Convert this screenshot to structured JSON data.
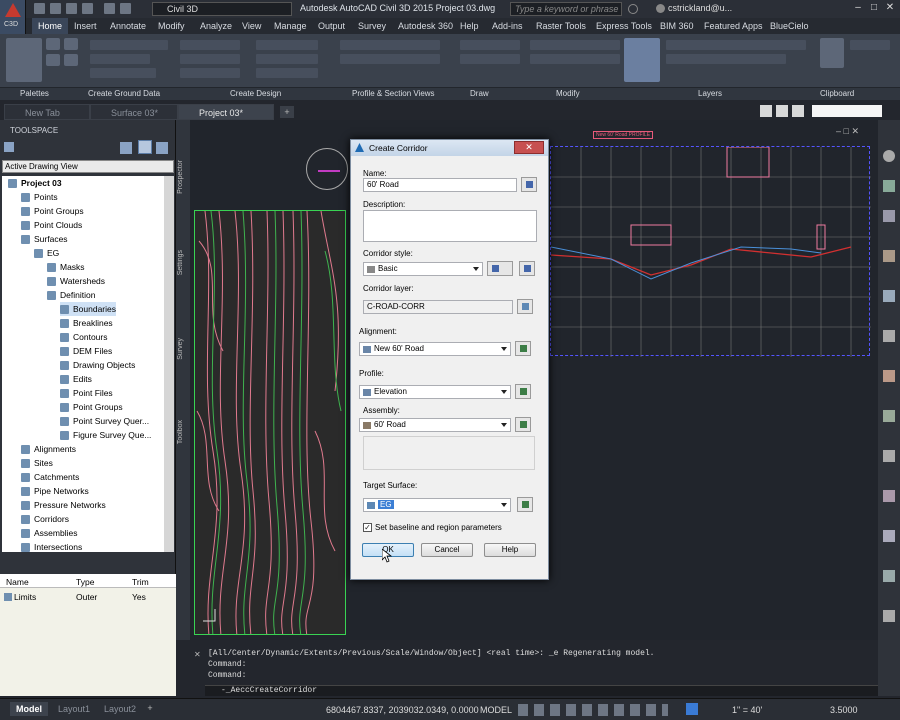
{
  "app": {
    "workspace": "Civil 3D",
    "title": "Autodesk AutoCAD Civil 3D 2015   Project 03.dwg",
    "search_placeholder": "Type a keyword or phrase",
    "user": "cstrickland@u...",
    "app_button_label": "C3D"
  },
  "ribbon": {
    "tabs": [
      "Home",
      "Insert",
      "Annotate",
      "Modify",
      "Analyze",
      "View",
      "Manage",
      "Output",
      "Survey",
      "Autodesk 360",
      "Help",
      "Add-ins",
      "Raster Tools",
      "Express Tools",
      "BIM 360",
      "Featured Apps",
      "BlueCielo"
    ],
    "active_tab": "Home",
    "panels": [
      "Palettes",
      "Create Ground Data",
      "Create Design",
      "Profile & Section Views",
      "Draw",
      "Modify",
      "Layers",
      "Clipboard"
    ]
  },
  "doc_tabs": [
    "New Tab",
    "Surface 03*",
    "Project 03*"
  ],
  "toolspace": {
    "title": "TOOLSPACE",
    "view": "Active Drawing View",
    "side_tabs": [
      "Prospector",
      "Settings",
      "Survey",
      "Toolbox"
    ],
    "tree": [
      {
        "label": "Project 03",
        "level": 0,
        "bold": true
      },
      {
        "label": "Points",
        "level": 1
      },
      {
        "label": "Point Groups",
        "level": 1
      },
      {
        "label": "Point Clouds",
        "level": 1
      },
      {
        "label": "Surfaces",
        "level": 1
      },
      {
        "label": "EG",
        "level": 2
      },
      {
        "label": "Masks",
        "level": 3
      },
      {
        "label": "Watersheds",
        "level": 3
      },
      {
        "label": "Definition",
        "level": 3
      },
      {
        "label": "Boundaries",
        "level": 4,
        "selected": true
      },
      {
        "label": "Breaklines",
        "level": 4
      },
      {
        "label": "Contours",
        "level": 4
      },
      {
        "label": "DEM Files",
        "level": 4
      },
      {
        "label": "Drawing Objects",
        "level": 4
      },
      {
        "label": "Edits",
        "level": 4
      },
      {
        "label": "Point Files",
        "level": 4
      },
      {
        "label": "Point Groups",
        "level": 4
      },
      {
        "label": "Point Survey Quer...",
        "level": 4
      },
      {
        "label": "Figure Survey Que...",
        "level": 4
      },
      {
        "label": "Alignments",
        "level": 1
      },
      {
        "label": "Sites",
        "level": 1
      },
      {
        "label": "Catchments",
        "level": 1
      },
      {
        "label": "Pipe Networks",
        "level": 1
      },
      {
        "label": "Pressure Networks",
        "level": 1
      },
      {
        "label": "Corridors",
        "level": 1
      },
      {
        "label": "Assemblies",
        "level": 1
      },
      {
        "label": "Intersections",
        "level": 1
      }
    ],
    "list_headers": [
      "Name",
      "Type",
      "Trim"
    ],
    "list_rows": [
      [
        "Limits",
        "Outer",
        "Yes"
      ]
    ]
  },
  "dialog": {
    "title": "Create Corridor",
    "close": "✕",
    "name_label": "Name:",
    "name_value": "60' Road",
    "description_label": "Description:",
    "description_value": "",
    "style_label": "Corridor style:",
    "style_value": "Basic",
    "layer_label": "Corridor layer:",
    "layer_value": "C-ROAD-CORR",
    "alignment_label": "Alignment:",
    "alignment_value": "New 60' Road",
    "profile_label": "Profile:",
    "profile_value": "Elevation",
    "assembly_label": "Assembly:",
    "assembly_value": "60' Road",
    "target_label": "Target Surface:",
    "target_value": "EG",
    "baseline_checkbox": "Set baseline and region parameters",
    "baseline_checked": true,
    "ok": "OK",
    "cancel": "Cancel",
    "help": "Help"
  },
  "command": {
    "line1": "[All/Center/Dynamic/Extents/Previous/Scale/Window/Object] <real time>: _e Regenerating model.",
    "line2": "Command:",
    "line3": "Command:",
    "input": "-_AeccCreateCorridor"
  },
  "status": {
    "tabs": [
      "Model",
      "Layout1",
      "Layout2"
    ],
    "coords": "6804467.8337, 2039032.0349, 0.0000",
    "mode": "MODEL",
    "scale": "1\" = 40'",
    "value": "3.5000"
  },
  "profile_label": "New 60' Road PROFILE"
}
